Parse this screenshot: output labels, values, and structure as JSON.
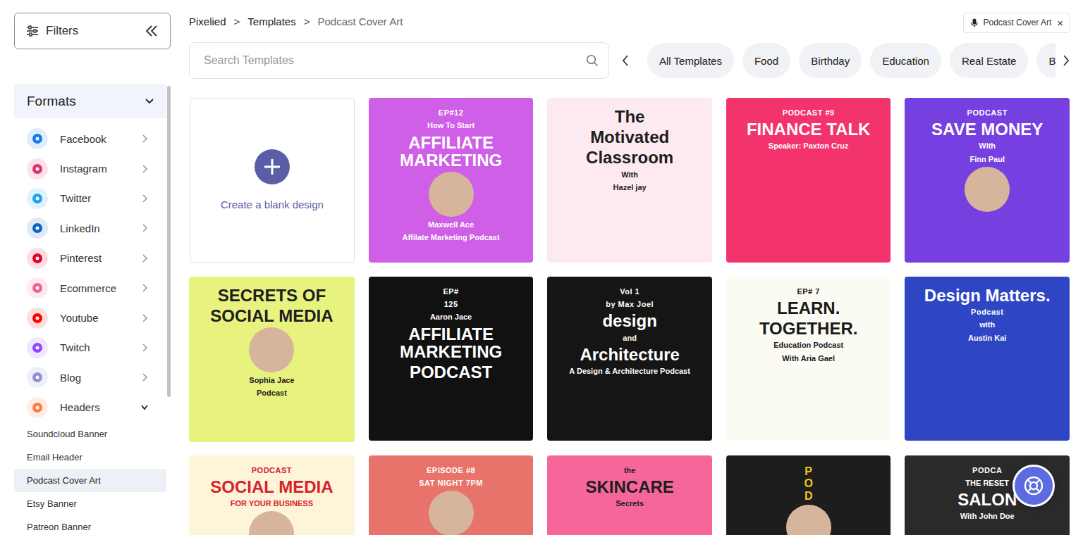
{
  "sidebar": {
    "filters_button": {
      "label": "Filters"
    },
    "section": {
      "label": "Formats",
      "expanded": true
    },
    "scrollbar": {
      "level": 0.69
    },
    "items": [
      {
        "label": "Facebook",
        "color": "#1877f2",
        "expanded": false,
        "children": []
      },
      {
        "label": "Instagram",
        "color": "#e1306c",
        "expanded": false,
        "children": []
      },
      {
        "label": "Twitter",
        "color": "#1da1f2",
        "expanded": false,
        "children": []
      },
      {
        "label": "LinkedIn",
        "color": "#0a66c2",
        "expanded": false,
        "children": []
      },
      {
        "label": "Pinterest",
        "color": "#e60023",
        "expanded": false,
        "children": []
      },
      {
        "label": "Ecommerce",
        "color": "#f06292",
        "expanded": false,
        "children": []
      },
      {
        "label": "Youtube",
        "color": "#ff0000",
        "expanded": false,
        "children": []
      },
      {
        "label": "Twitch",
        "color": "#9146ff",
        "expanded": false,
        "children": []
      },
      {
        "label": "Blog",
        "color": "#8f8fd6",
        "expanded": false,
        "children": []
      },
      {
        "label": "Headers",
        "color": "#ff7a3d",
        "expanded": true,
        "children": [
          {
            "label": "Soundcloud Banner",
            "selected": false
          },
          {
            "label": "Email Header",
            "selected": false
          },
          {
            "label": "Podcast Cover Art",
            "selected": true
          },
          {
            "label": "Etsy Banner",
            "selected": false
          },
          {
            "label": "Patreon Banner",
            "selected": false
          }
        ]
      }
    ]
  },
  "breadcrumb": {
    "separator": ">",
    "items": [
      {
        "label": "Pixelied",
        "current": false
      },
      {
        "label": "Templates",
        "current": false
      },
      {
        "label": "Podcast Cover Art",
        "current": true
      }
    ]
  },
  "active_filter": {
    "label": "Podcast Cover Art",
    "close": "×"
  },
  "search": {
    "placeholder": "Search Templates"
  },
  "categories": [
    {
      "label": "All Templates",
      "selected": false
    },
    {
      "label": "Food",
      "selected": false
    },
    {
      "label": "Birthday",
      "selected": false
    },
    {
      "label": "Education",
      "selected": false
    },
    {
      "label": "Real Estate",
      "selected": false
    },
    {
      "label": "Bus",
      "selected": false
    }
  ],
  "blank_card": {
    "label": "Create a blank design"
  },
  "templates": [
    {
      "color": "#cf5fe6",
      "ink": "#ffffff",
      "parts": [
        {
          "kind": "tag",
          "text": "EP#12"
        },
        {
          "kind": "small",
          "text": "How To Start"
        },
        {
          "kind": "title",
          "text": "AFFILIATE MARKETING"
        },
        {
          "kind": "photo"
        },
        {
          "kind": "small",
          "text": "Maxwell Ace"
        },
        {
          "kind": "small",
          "text": "Affilate Marketing Podcast"
        }
      ]
    },
    {
      "color": "#fdeaf0",
      "ink": "#1e1e1e",
      "parts": [
        {
          "kind": "title",
          "text": "The"
        },
        {
          "kind": "title",
          "text": "Motivated"
        },
        {
          "kind": "title",
          "text": "Classroom"
        },
        {
          "kind": "small",
          "text": "With"
        },
        {
          "kind": "small",
          "text": "Hazel jay"
        }
      ]
    },
    {
      "color": "#f2336c",
      "ink": "#ffffff",
      "parts": [
        {
          "kind": "tag",
          "text": "PODCAST #9"
        },
        {
          "kind": "title",
          "text": "FINANCE TALK"
        },
        {
          "kind": "small",
          "text": "Speaker: Paxton Cruz"
        }
      ]
    },
    {
      "color": "#7640e0",
      "ink": "#ffffff",
      "parts": [
        {
          "kind": "tag",
          "text": "PODCAST"
        },
        {
          "kind": "title",
          "text": "SAVE MONEY"
        },
        {
          "kind": "small",
          "text": "With"
        },
        {
          "kind": "small",
          "text": "Finn Paul"
        },
        {
          "kind": "photo"
        }
      ]
    },
    {
      "color": "#e8f27f",
      "ink": "#1e1e1e",
      "parts": [
        {
          "kind": "title",
          "text": "SECRETS OF"
        },
        {
          "kind": "title",
          "text": "SOCIAL MEDIA"
        },
        {
          "kind": "photo"
        },
        {
          "kind": "small",
          "text": "Sophia Jace"
        },
        {
          "kind": "small",
          "text": "Podcast"
        }
      ]
    },
    {
      "color": "#111111",
      "ink": "#ffffff",
      "parts": [
        {
          "kind": "tag",
          "text": "EP#"
        },
        {
          "kind": "tag",
          "text": "125"
        },
        {
          "kind": "small",
          "text": "Aaron Jace"
        },
        {
          "kind": "title",
          "text": "AFFILIATE MARKETING"
        },
        {
          "kind": "title",
          "text": "PODCAST"
        }
      ]
    },
    {
      "color": "#151515",
      "ink": "#ffffff",
      "parts": [
        {
          "kind": "tag",
          "text": "Vol 1"
        },
        {
          "kind": "tag",
          "text": "by Max Joel"
        },
        {
          "kind": "title",
          "text": "design"
        },
        {
          "kind": "small",
          "text": "and"
        },
        {
          "kind": "title",
          "text": "Architecture"
        },
        {
          "kind": "small",
          "text": "A Design & Architecture Podcast"
        }
      ]
    },
    {
      "color": "#fbfbf3",
      "ink": "#1a1a1a",
      "parts": [
        {
          "kind": "tag",
          "text": "EP# 7"
        },
        {
          "kind": "title",
          "text": "LEARN."
        },
        {
          "kind": "title",
          "text": "TOGETHER."
        },
        {
          "kind": "small",
          "text": "Education Podcast"
        },
        {
          "kind": "small",
          "text": "With Aria Gael"
        }
      ]
    },
    {
      "color": "#2f46c4",
      "ink": "#ffffff",
      "parts": [
        {
          "kind": "title",
          "text": "Design Matters."
        },
        {
          "kind": "tag",
          "text": "Podcast"
        },
        {
          "kind": "small",
          "text": "with"
        },
        {
          "kind": "small",
          "text": "Austin Kai"
        }
      ]
    },
    {
      "color": "#fdf4d9",
      "ink": "#d8232a",
      "parts": [
        {
          "kind": "tag",
          "text": "PODCAST"
        },
        {
          "kind": "title",
          "text": "SOCIAL MEDIA"
        },
        {
          "kind": "small",
          "text": "FOR YOUR BUSINESS"
        },
        {
          "kind": "photo"
        }
      ]
    },
    {
      "color": "#e8736a",
      "ink": "#ffffff",
      "parts": [
        {
          "kind": "tag",
          "text": "EPISODE #8"
        },
        {
          "kind": "tag",
          "text": "SAT NIGHT 7PM"
        },
        {
          "kind": "photo"
        }
      ]
    },
    {
      "color": "#f7669a",
      "ink": "#1e1e1e",
      "parts": [
        {
          "kind": "small",
          "text": "the"
        },
        {
          "kind": "title",
          "text": "SKINCARE"
        },
        {
          "kind": "small",
          "text": "Secrets"
        }
      ]
    },
    {
      "color": "#1d1d1d",
      "ink": "#f5c518",
      "parts": [
        {
          "kind": "vertical",
          "text": "POD"
        },
        {
          "kind": "photo"
        }
      ]
    },
    {
      "color": "#2a2a2a",
      "ink": "#ffffff",
      "parts": [
        {
          "kind": "tag",
          "text": "PODCA"
        },
        {
          "kind": "small",
          "text": "THE RESET"
        },
        {
          "kind": "title",
          "text": "SALON"
        },
        {
          "kind": "small",
          "text": "With John Doe"
        }
      ]
    }
  ]
}
